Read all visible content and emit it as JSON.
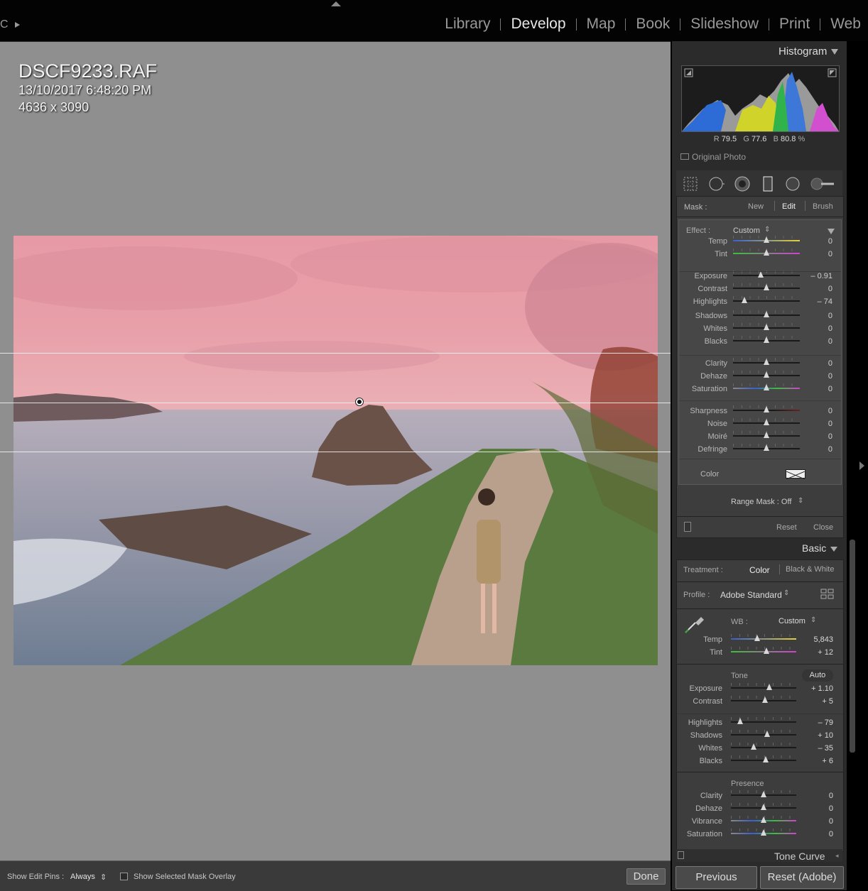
{
  "topbar": {
    "left_mark": "C",
    "modules": [
      "Library",
      "Develop",
      "Map",
      "Book",
      "Slideshow",
      "Print",
      "Web"
    ],
    "active_module": "Develop"
  },
  "image_info": {
    "filename": "DSCF9233.RAF",
    "datetime": "13/10/2017 6:48:20 PM",
    "dimensions": "4636 x 3090"
  },
  "toolbar": {
    "edit_pins_label": "Show Edit Pins :",
    "edit_pins_value": "Always",
    "mask_overlay_label": "Show Selected Mask Overlay",
    "done_label": "Done"
  },
  "histogram": {
    "title": "Histogram",
    "r_label": "R",
    "r_value": "79.5",
    "g_label": "G",
    "g_value": "77.6",
    "b_label": "B",
    "b_value": "80.8",
    "unit": "%",
    "original_photo_label": "Original Photo"
  },
  "mask": {
    "label": "Mask :",
    "new_label": "New",
    "edit_label": "Edit",
    "brush_label": "Brush",
    "effect_label": "Effect :",
    "effect_value": "Custom",
    "range_mask_label": "Range Mask : Off",
    "reset_label": "Reset",
    "close_label": "Close",
    "color_label": "Color",
    "sliders": [
      {
        "label": "Temp",
        "value": "0",
        "pos": 0.5
      },
      {
        "label": "Tint",
        "value": "0",
        "pos": 0.5
      },
      {
        "label": "Exposure",
        "value": "– 0.91",
        "pos": 0.41
      },
      {
        "label": "Contrast",
        "value": "0",
        "pos": 0.5
      },
      {
        "label": "Highlights",
        "value": "– 74",
        "pos": 0.17
      },
      {
        "label": "Shadows",
        "value": "0",
        "pos": 0.5
      },
      {
        "label": "Whites",
        "value": "0",
        "pos": 0.5
      },
      {
        "label": "Blacks",
        "value": "0",
        "pos": 0.5
      },
      {
        "label": "Clarity",
        "value": "0",
        "pos": 0.5
      },
      {
        "label": "Dehaze",
        "value": "0",
        "pos": 0.5
      },
      {
        "label": "Saturation",
        "value": "0",
        "pos": 0.5
      },
      {
        "label": "Sharpness",
        "value": "0",
        "pos": 0.5
      },
      {
        "label": "Noise",
        "value": "0",
        "pos": 0.5
      },
      {
        "label": "Moiré",
        "value": "0",
        "pos": 0.5
      },
      {
        "label": "Defringe",
        "value": "0",
        "pos": 0.5
      }
    ]
  },
  "basic": {
    "title": "Basic",
    "treatment_label": "Treatment :",
    "treatment_color": "Color",
    "treatment_bw": "Black & White",
    "profile_label": "Profile :",
    "profile_value": "Adobe Standard",
    "wb_label": "WB :",
    "wb_value": "Custom",
    "tone_label": "Tone",
    "auto_label": "Auto",
    "presence_label": "Presence",
    "sliders": [
      {
        "label": "Temp",
        "value": "5,843",
        "pos": 0.4
      },
      {
        "label": "Tint",
        "value": "+ 12",
        "pos": 0.54
      },
      {
        "label": "Exposure",
        "value": "+ 1.10",
        "pos": 0.59
      },
      {
        "label": "Contrast",
        "value": "+ 5",
        "pos": 0.52
      },
      {
        "label": "Highlights",
        "value": "– 79",
        "pos": 0.14
      },
      {
        "label": "Shadows",
        "value": "+ 10",
        "pos": 0.55
      },
      {
        "label": "Whites",
        "value": "– 35",
        "pos": 0.35
      },
      {
        "label": "Blacks",
        "value": "+ 6",
        "pos": 0.53
      },
      {
        "label": "Clarity",
        "value": "0",
        "pos": 0.5
      },
      {
        "label": "Dehaze",
        "value": "0",
        "pos": 0.5
      },
      {
        "label": "Vibrance",
        "value": "0",
        "pos": 0.5
      },
      {
        "label": "Saturation",
        "value": "0",
        "pos": 0.5
      }
    ]
  },
  "tone_curve_label": "Tone Curve",
  "buttons": {
    "previous": "Previous",
    "reset": "Reset (Adobe)"
  }
}
